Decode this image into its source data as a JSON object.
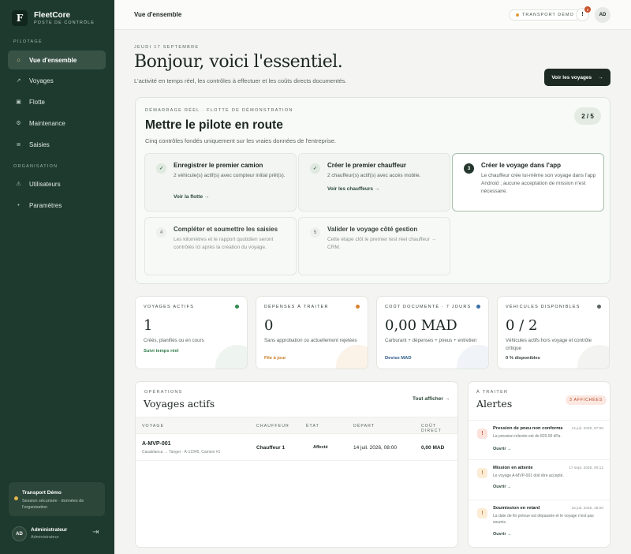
{
  "brand": {
    "logo": "F",
    "name": "FleetCore",
    "sub": "POSTE DE CONTRÔLE"
  },
  "sidebar": {
    "pilotage_label": "PILOTAGE",
    "organisation_label": "ORGANISATION",
    "items": [
      {
        "label": "Vue d'ensemble",
        "icon": "⌂"
      },
      {
        "label": "Voyages",
        "icon": "↗"
      },
      {
        "label": "Flotte",
        "icon": "▣"
      },
      {
        "label": "Maintenance",
        "icon": "⚙"
      },
      {
        "label": "Saisies",
        "icon": "≣"
      }
    ],
    "org_items": [
      {
        "label": "Utilisateurs",
        "icon": "⚠"
      },
      {
        "label": "Paramètres",
        "icon": "•"
      }
    ],
    "org_card": {
      "title": "Transport Démo",
      "sub": "Session sécurisée · données de l'organisation"
    },
    "user": {
      "initials": "AD",
      "name": "Administrateur",
      "role": "Administrateur",
      "logout_icon": "⇥"
    }
  },
  "topbar": {
    "title": "Vue d'ensemble",
    "chip": "TRANSPORT DÉMO",
    "notif_icon": "!",
    "notif_count": "3",
    "avatar": "AD"
  },
  "header": {
    "date": "JEUDI 17 SEPTEMBRE",
    "greeting": "Bonjour, voici l'essentiel.",
    "subtitle": "L'activité en temps réel, les contrôles à effectuer et les coûts directs documentés.",
    "cta": "Voir les voyages",
    "cta_arrow": "→"
  },
  "onboarding": {
    "tag": "DÉMARRAGE RÉEL · FLOTTE DE DÉMONSTRATION",
    "title": "Mettre le pilote en route",
    "sub": "Cinq contrôles fondés uniquement sur les vraies données de l'entreprise.",
    "progress": "2 / 5",
    "steps": [
      {
        "badge": "✓",
        "title": "Enregistrer le premier camion",
        "desc": "2 véhicule(s) actif(s) avec compteur initial prêt(s).",
        "link": "Voir la flotte →"
      },
      {
        "badge": "✓",
        "title": "Créer le premier chauffeur",
        "desc": "2 chauffeur(s) actif(s) avec accès mobile.",
        "link": "Voir les chauffeurs →"
      },
      {
        "badge": "3",
        "title": "Créer le voyage dans l'app",
        "desc": "Le chauffeur crée lui-même son voyage dans l'app Android ; aucune acceptation de mission n'est nécessaire.",
        "link": ""
      },
      {
        "badge": "4",
        "title": "Compléter et soumettre les saisies",
        "desc": "Les kilomètres et le rapport quotidien seront contrôlés ici après la création du voyage.",
        "link": ""
      },
      {
        "badge": "5",
        "title": "Valider le voyage côté gestion",
        "desc": "Cette étape clôt le premier test réel chauffeur → CRM.",
        "link": ""
      }
    ]
  },
  "stats": [
    {
      "label": "VOYAGES ACTIFS",
      "value": "1",
      "sub": "Créés, planifiés ou en cours",
      "link": "Suivi temps réel",
      "color": "#2f8a4f"
    },
    {
      "label": "DÉPENSES À TRAITER",
      "value": "0",
      "sub": "Sans approbation ou actuellement rejetées",
      "link": "File à jour",
      "color": "#d9822b"
    },
    {
      "label": "COÛT DOCUMENTÉ · 7 JOURS",
      "value": "0,00 MAD",
      "sub": "Carburant + dépenses + pneus + entretien",
      "link": "Devise MAD",
      "color": "#3a6ea5"
    },
    {
      "label": "VÉHICULES DISPONIBLES",
      "value": "0 / 2",
      "sub": "Véhicules actifs hors voyage et contrôle critique",
      "link": "0 % disponibles",
      "color": "#5a645e"
    }
  ],
  "trips": {
    "tag": "OPÉRATIONS",
    "title": "Voyages actifs",
    "show_all": "Tout afficher →",
    "columns": [
      "VOYAGE",
      "CHAUFFEUR",
      "ÉTAT",
      "DÉPART",
      "COÛT DIRECT"
    ],
    "rows": [
      {
        "id": "A-MVP-001",
        "route": "Casablanca → Tanger · A-12345, Camion #1",
        "driver": "Chauffeur 1",
        "state": "Affecté",
        "departure": "14 juil. 2026, 08:00",
        "cost": "0,00 MAD"
      }
    ]
  },
  "alerts": {
    "tag": "À TRAITER",
    "title": "Alertes",
    "count": "3 AFFICHÉES",
    "items": [
      {
        "icon": "!",
        "title": "Pression de pneu non conforme",
        "time": "14 juil. 2026, 07:00",
        "desc": "La pression relevée est de 820.00 kPa.",
        "link": "Ouvrir →",
        "color": "#c9532e"
      },
      {
        "icon": "!",
        "title": "Mission en attente",
        "time": "17 sept. 2026, 00:12",
        "desc": "Le voyage A-MVP-001 doit être accepté.",
        "link": "Ouvrir →",
        "color": "#d9822b"
      },
      {
        "icon": "!",
        "title": "Soumission en retard",
        "time": "15 juil. 2026, 18:00",
        "desc": "La date de fin prévue est dépassée et le voyage n'est pas soumis.",
        "link": "Ouvrir →",
        "color": "#d9822b"
      }
    ]
  }
}
